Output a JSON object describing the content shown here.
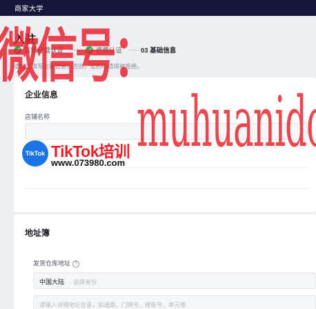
{
  "header": {
    "title": "商家大学"
  },
  "page": {
    "title": "入驻"
  },
  "steps": [
    {
      "label": "店铺经营认证",
      "status": "done"
    },
    {
      "label": "资质认证",
      "status": "done"
    },
    {
      "label": "03 基础信息",
      "status": "current"
    }
  ],
  "hint": "请如实填写店铺信息，否则，您的申请将被拒绝。",
  "company_section": {
    "title": "企业信息",
    "store_name_label": "店铺名称"
  },
  "address_section": {
    "title": "地址簿",
    "warehouse_label": "发货仓库地址",
    "help_icon_glyph": "?",
    "region_value": "中国大陆",
    "region_placeholder": "- 选择省份",
    "detail_placeholder": "请输入详细地址信息，如道路、门牌号、楼栋号、单元等"
  },
  "watermark": {
    "cn_text": "微信号：",
    "latin_text": "muhuanidc",
    "logo_badge": "TikTok",
    "logo_text": "TikTok培训",
    "logo_url": "www.073980.com"
  },
  "colors": {
    "topbar": "#14173a",
    "success": "#22b35e",
    "watermark_red": "#e81e28",
    "logo_blue": "#1b74e4"
  }
}
